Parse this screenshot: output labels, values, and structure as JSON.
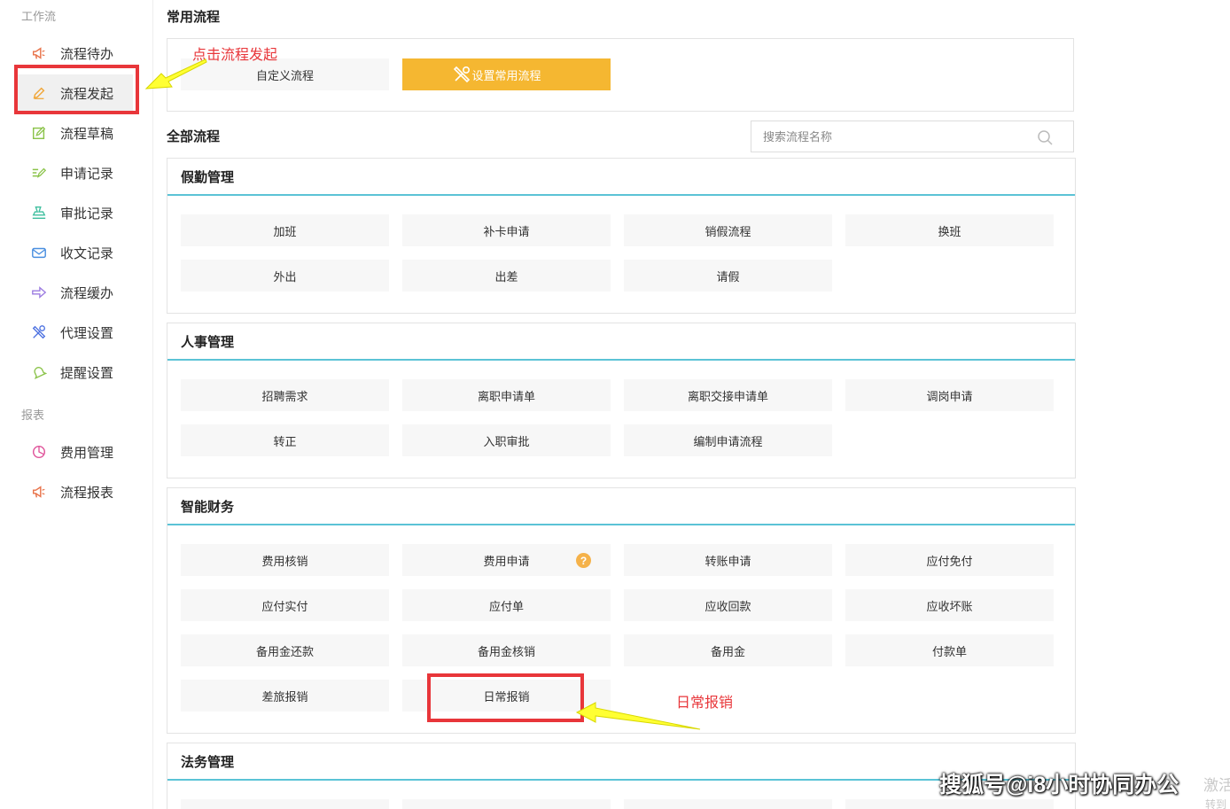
{
  "sidebar": {
    "group_workflow": "工作流",
    "group_report": "报表",
    "items": [
      {
        "label": "流程待办",
        "icon": "megaphone-icon",
        "color": "#e8734a"
      },
      {
        "label": "流程发起",
        "icon": "pencil-icon",
        "color": "#f0a73a"
      },
      {
        "label": "流程草稿",
        "icon": "draft-edit-icon",
        "color": "#8bc34a"
      },
      {
        "label": "申请记录",
        "icon": "apply-record-icon",
        "color": "#8bc34a"
      },
      {
        "label": "审批记录",
        "icon": "stamp-icon",
        "color": "#3fbf9f"
      },
      {
        "label": "收文记录",
        "icon": "envelope-icon",
        "color": "#4a8fe0"
      },
      {
        "label": "流程缓办",
        "icon": "arrow-right-icon",
        "color": "#9b7be0"
      },
      {
        "label": "代理设置",
        "icon": "tools-icon",
        "color": "#4a6fe0"
      },
      {
        "label": "提醒设置",
        "icon": "bell-icon",
        "color": "#8bc34a"
      },
      {
        "label": "费用管理",
        "icon": "pie-chart-icon",
        "color": "#e0559b"
      },
      {
        "label": "流程报表",
        "icon": "megaphone-icon",
        "color": "#e8734a"
      }
    ]
  },
  "common": {
    "title": "常用流程",
    "custom_label": "自定义流程",
    "set_label": "设置常用流程"
  },
  "all": {
    "title": "全部流程",
    "search_placeholder": "搜索流程名称"
  },
  "panels": [
    {
      "title": "假勤管理",
      "items": [
        "加班",
        "补卡申请",
        "销假流程",
        "换班",
        "外出",
        "出差",
        "请假"
      ]
    },
    {
      "title": "人事管理",
      "items": [
        "招聘需求",
        "离职申请单",
        "离职交接申请单",
        "调岗申请",
        "转正",
        "入职审批",
        "编制申请流程"
      ]
    },
    {
      "title": "智能财务",
      "items": [
        "费用核销",
        "费用申请",
        "转账申请",
        "应付免付",
        "应付实付",
        "应付单",
        "应收回款",
        "应收坏账",
        "备用金还款",
        "备用金核销",
        "备用金",
        "付款单",
        "差旅报销",
        "日常报销"
      ]
    },
    {
      "title": "法务管理",
      "items": []
    }
  ],
  "help_mark": "?",
  "annotations": {
    "click_start": "点击流程发起",
    "daily_expense": "日常报销"
  },
  "watermark": "搜狐号@i8小时协同办公",
  "activate_line1": "激活",
  "activate_line2": "转到"
}
